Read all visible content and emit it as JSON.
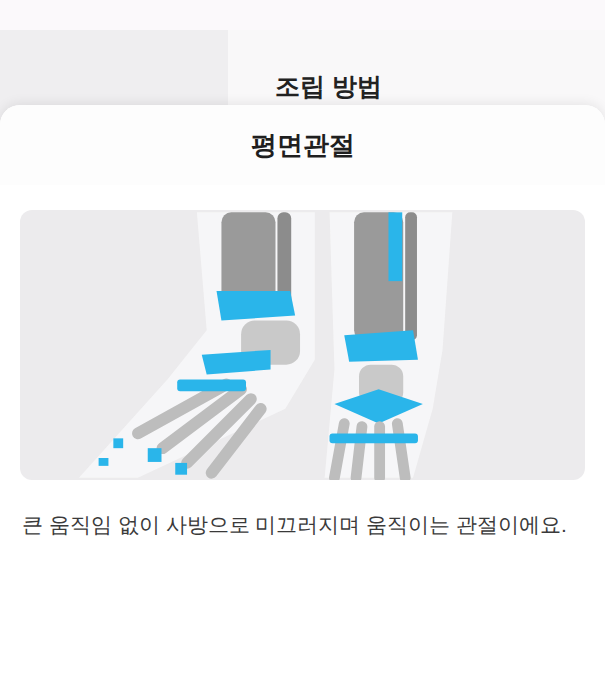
{
  "background": {
    "title": "조립 방법"
  },
  "sheet": {
    "title": "평면관절",
    "description": "큰 움직임 없이 사방으로 미끄러지며 움직이는 관절이에요."
  }
}
